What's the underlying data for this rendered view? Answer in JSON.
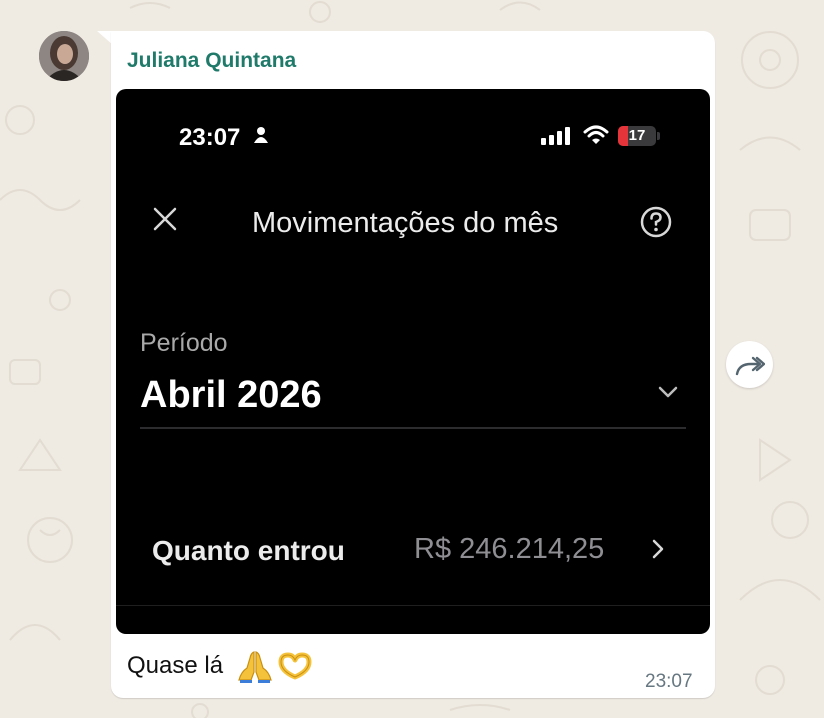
{
  "message": {
    "sender_name": "Juliana Quintana",
    "caption": "Quase lá",
    "emojis": [
      "folded-hands",
      "heart-hands"
    ],
    "sent_time": "23:07"
  },
  "shared_screenshot": {
    "status_bar": {
      "time": "23:07",
      "battery_level": "17"
    },
    "title": "Movimentações do mês",
    "period_label": "Período",
    "period_value": "Abril 2026",
    "income_label": "Quanto entrou",
    "income_value": "R$ 246.214,25"
  },
  "colors": {
    "chat_background": "#efeae2",
    "sender_name": "#1f7a6a",
    "bubble": "#ffffff",
    "battery_low": "#e5353a"
  }
}
